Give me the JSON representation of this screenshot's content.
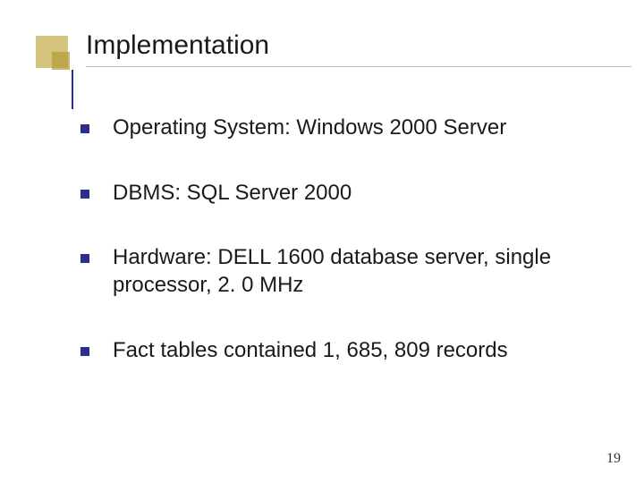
{
  "title": "Implementation",
  "bullets": [
    "Operating System: Windows 2000 Server",
    "DBMS: SQL Server 2000",
    "Hardware: DELL 1600 database server, single processor, 2. 0 MHz",
    "Fact tables contained 1, 685, 809 records"
  ],
  "page_number": "19"
}
